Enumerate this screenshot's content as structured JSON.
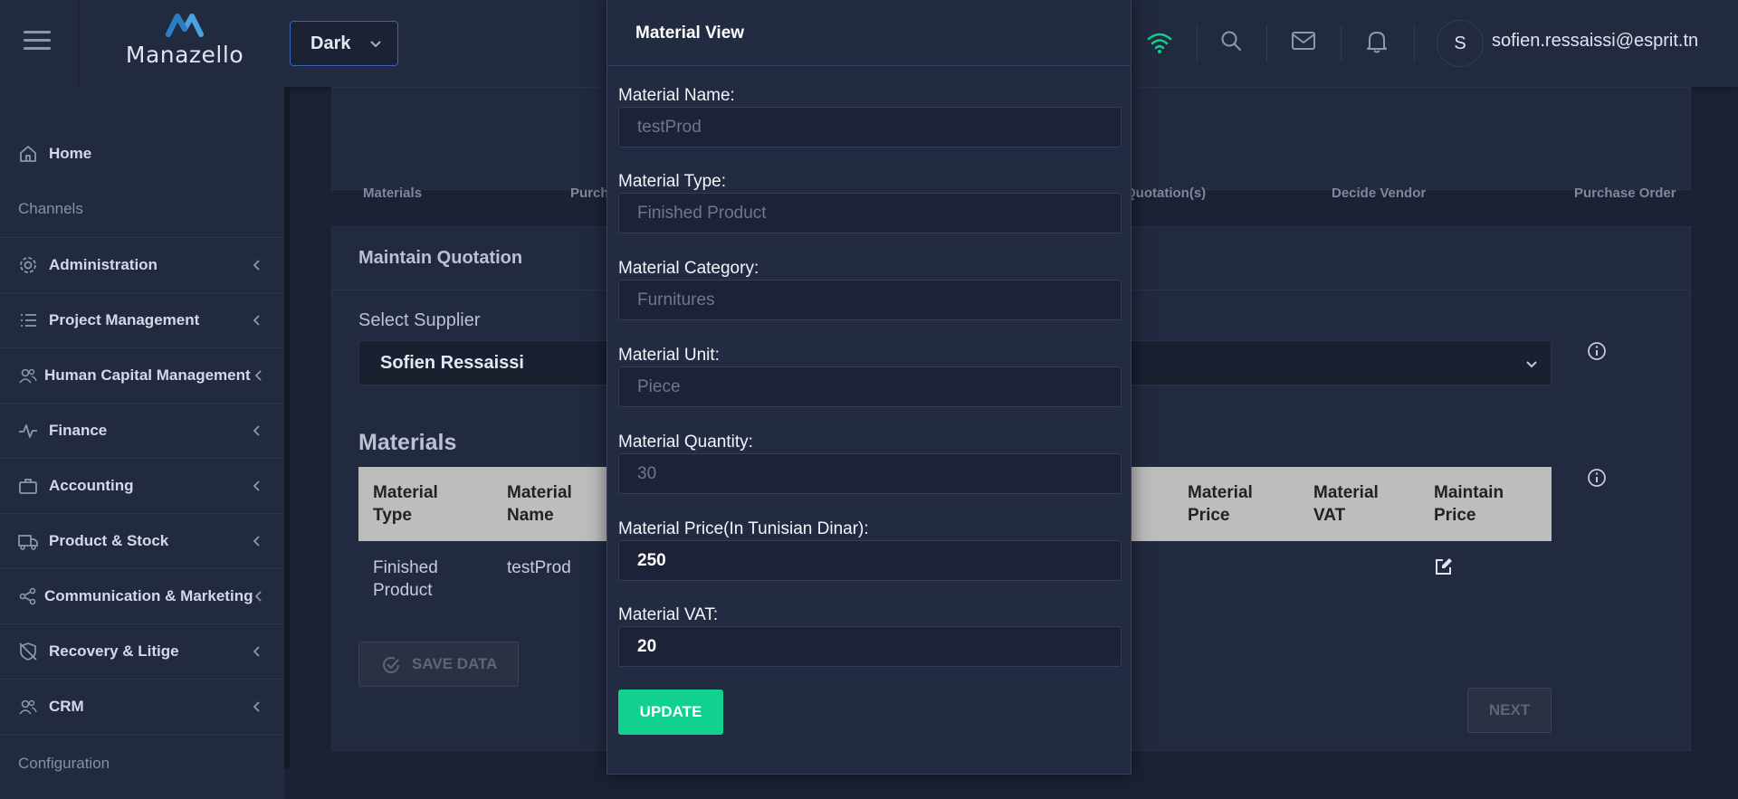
{
  "header": {
    "logo_text": "Manazello",
    "theme_select": "Dark",
    "avatar_initial": "S",
    "user_email": "sofien.ressaissi@esprit.tn"
  },
  "sidebar": {
    "home": "Home",
    "channels_section": "Channels",
    "items": [
      {
        "label": "Administration",
        "icon": "gear-icon"
      },
      {
        "label": "Project Management",
        "icon": "list-icon"
      },
      {
        "label": "Human Capital Management",
        "icon": "users-icon"
      },
      {
        "label": "Finance",
        "icon": "pulse-icon"
      },
      {
        "label": "Accounting",
        "icon": "briefcase-icon"
      },
      {
        "label": "Product & Stock",
        "icon": "truck-icon"
      },
      {
        "label": "Communication & Marketing",
        "icon": "share-icon"
      },
      {
        "label": "Recovery & Litige",
        "icon": "shield-off-icon"
      },
      {
        "label": "CRM",
        "icon": "users-icon"
      }
    ],
    "configuration_section": "Configuration"
  },
  "steps": {
    "materials": "Materials",
    "purchase_partial": "Purch",
    "quotations_partial": "Quotation(s)",
    "decide_vendor": "Decide Vendor",
    "purchase_order": "Purchase Order"
  },
  "quotation": {
    "title": "Maintain Quotation",
    "select_supplier_label": "Select Supplier",
    "selected_supplier": "Sofien Ressaissi",
    "materials_heading": "Materials",
    "columns": {
      "type_1": "Material",
      "type_2": "Type",
      "name_1": "Material",
      "name_2": "Name",
      "price_1": "Material",
      "price_2": "Price",
      "vat_1": "Material",
      "vat_2": "VAT",
      "maintain_1": "Maintain",
      "maintain_2": "Price"
    },
    "row": {
      "type_1": "Finished",
      "type_2": "Product",
      "name": "testProd"
    },
    "save_button": "SAVE DATA",
    "next_button": "NEXT"
  },
  "modal": {
    "title": "Material View",
    "name_label": "Material Name:",
    "name_value": "testProd",
    "type_label": "Material Type:",
    "type_value": "Finished Product",
    "category_label": "Material Category:",
    "category_value": "Furnitures",
    "unit_label": "Material Unit:",
    "unit_value": "Piece",
    "quantity_label": "Material Quantity:",
    "quantity_value": "30",
    "price_label": "Material Price(In Tunisian Dinar):",
    "price_value": "250",
    "vat_label": "Material VAT:",
    "vat_value": "20",
    "update_button": "UPDATE"
  },
  "colors": {
    "accent_green": "#10d18e",
    "wifi_green": "#10d18e",
    "theme_border": "#3a64b8"
  }
}
